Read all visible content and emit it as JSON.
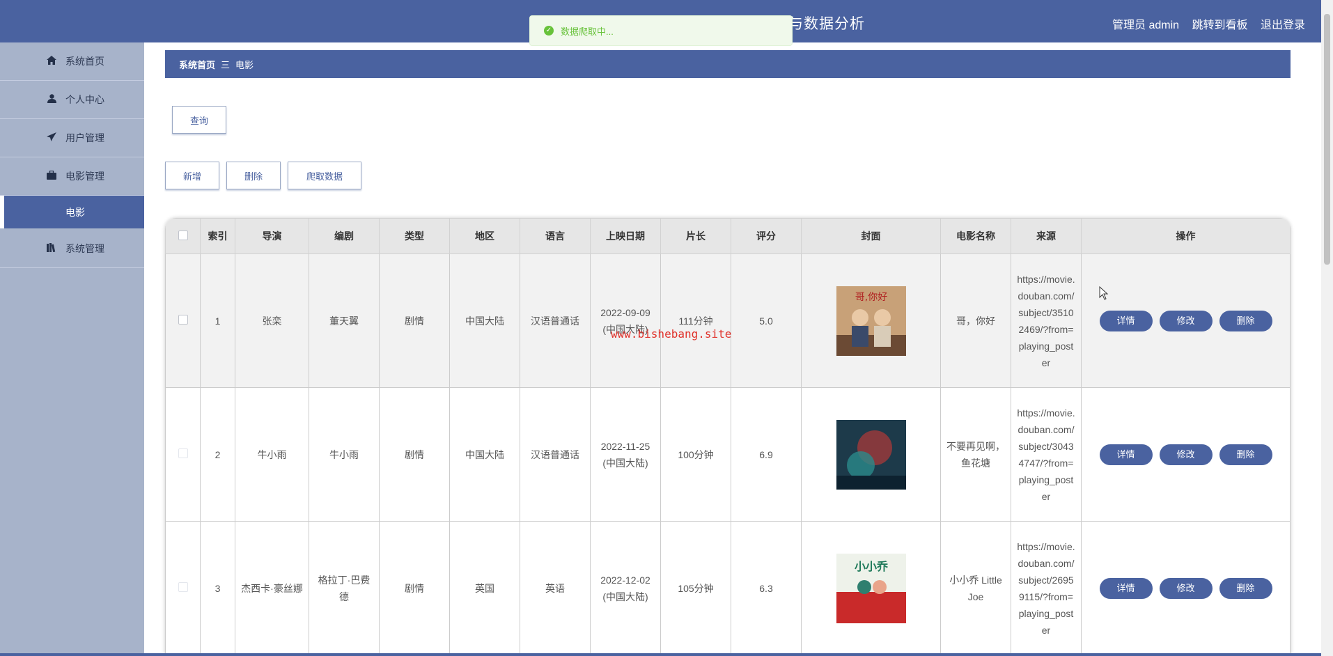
{
  "header": {
    "title_visible": "与数据分析",
    "user_label": "管理员 admin",
    "dashboard_link": "跳转到看板",
    "logout_link": "退出登录"
  },
  "toast": {
    "message": "数据爬取中..."
  },
  "sidebar": {
    "items": [
      {
        "label": "系统首页",
        "icon": "home-icon"
      },
      {
        "label": "个人中心",
        "icon": "user-icon"
      },
      {
        "label": "用户管理",
        "icon": "paper-plane-icon"
      },
      {
        "label": "电影管理",
        "icon": "briefcase-icon"
      },
      {
        "label": "电影",
        "icon": ""
      },
      {
        "label": "系统管理",
        "icon": "book-icon"
      }
    ]
  },
  "breadcrumb": {
    "home": "系统首页",
    "separator": "三",
    "current": "电影"
  },
  "toolbar": {
    "query_label": "查询",
    "add_label": "新增",
    "delete_label": "删除",
    "crawl_label": "爬取数据"
  },
  "table": {
    "headers": [
      "",
      "索引",
      "导演",
      "编剧",
      "类型",
      "地区",
      "语言",
      "上映日期",
      "片长",
      "评分",
      "封面",
      "电影名称",
      "来源",
      "操作"
    ],
    "rows": [
      {
        "index": "1",
        "director": "张栾",
        "writer": "董天翼",
        "genre": "剧情",
        "region": "中国大陆",
        "language": "汉语普通话",
        "date": "2022-09-09(中国大陆)",
        "duration": "111分钟",
        "score": "5.0",
        "title": "哥，你好",
        "source": "https://movie.douban.com/subject/35102469/?from=playing_poster",
        "poster_text": "哥,你好"
      },
      {
        "index": "2",
        "director": "牛小雨",
        "writer": "牛小雨",
        "genre": "剧情",
        "region": "中国大陆",
        "language": "汉语普通话",
        "date": "2022-11-25(中国大陆)",
        "duration": "100分钟",
        "score": "6.9",
        "title": "不要再见啊，鱼花塘",
        "source": "https://movie.douban.com/subject/30434747/?from=playing_poster",
        "poster_text": ""
      },
      {
        "index": "3",
        "director": "杰西卡·豪丝娜",
        "writer": "格拉丁·巴费德",
        "genre": "剧情",
        "region": "英国",
        "language": "英语",
        "date": "2022-12-02(中国大陆)",
        "duration": "105分钟",
        "score": "6.3",
        "title": "小小乔 Little Joe",
        "source": "https://movie.douban.com/subject/26959115/?from=playing_poster",
        "poster_text": "小小乔"
      }
    ],
    "actions": {
      "detail": "详情",
      "edit": "修改",
      "delete": "删除"
    }
  },
  "watermark": "www.bishebang.site",
  "colors": {
    "primary": "#4a62a0",
    "sidebar": "#a7b3ca",
    "success": "#67c23a"
  }
}
